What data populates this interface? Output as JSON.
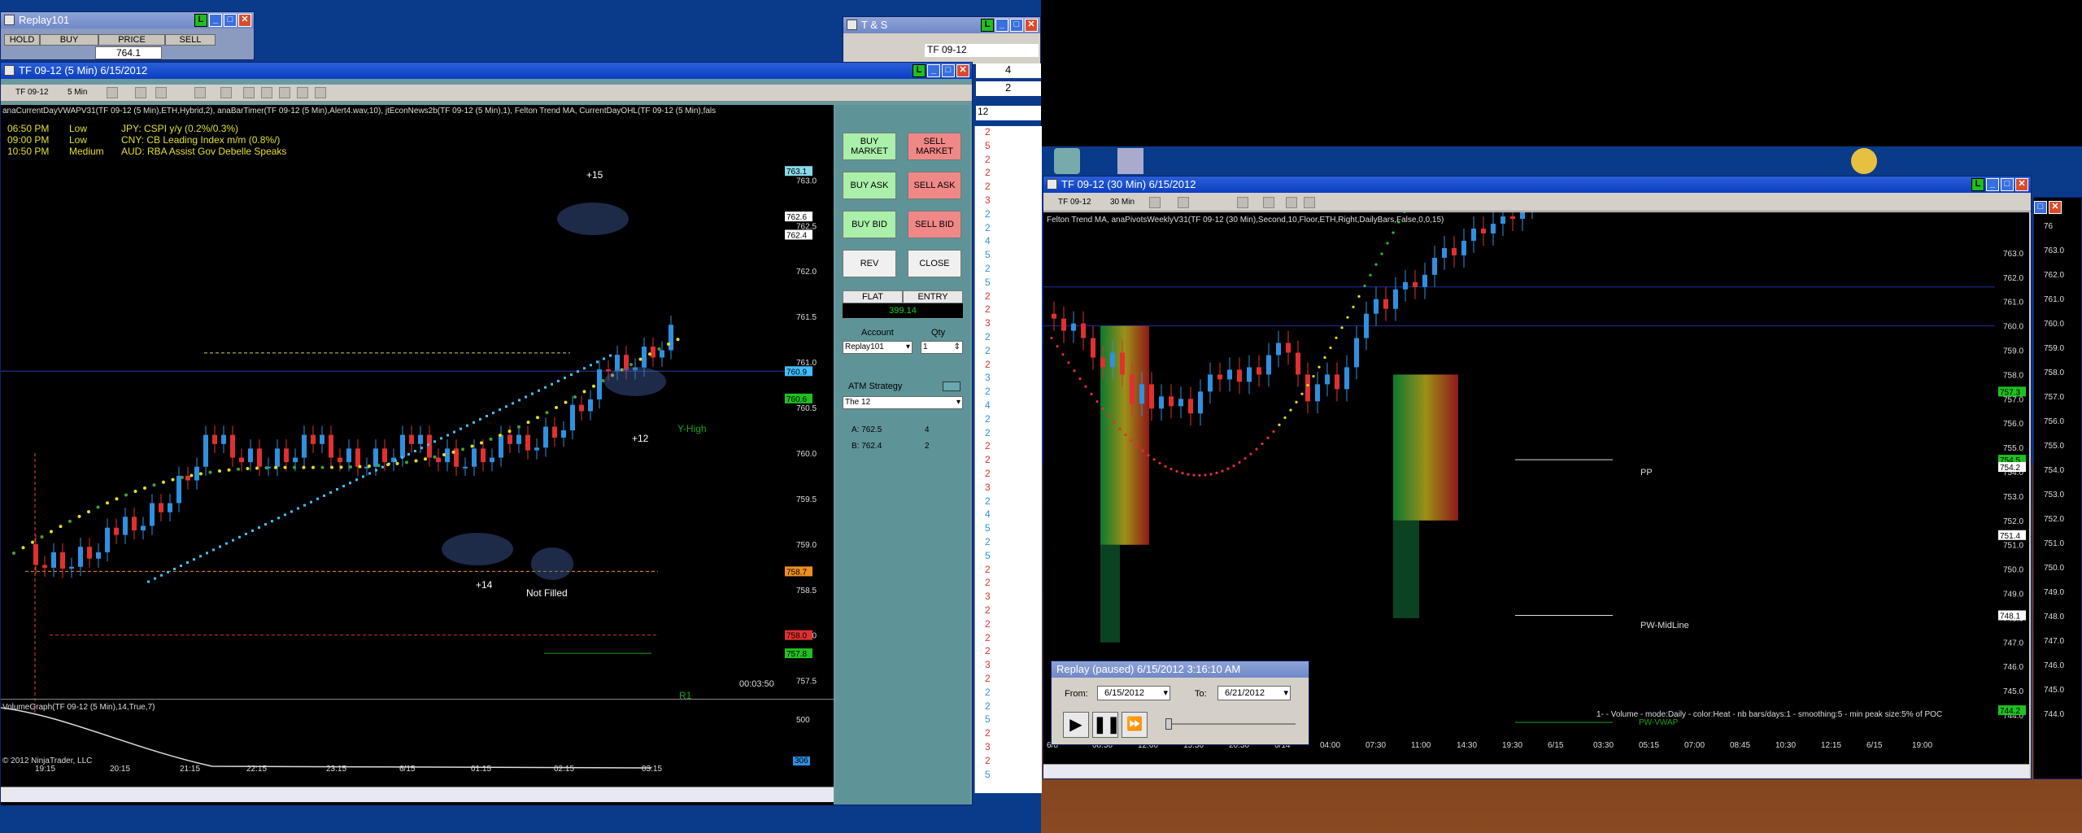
{
  "replay_win": {
    "title": "Replay101",
    "headers": [
      "HOLD",
      "BUY",
      "PRICE",
      "SELL"
    ],
    "price": "764.1"
  },
  "ts_win": {
    "title": "T & S",
    "instrument": "TF 09-12",
    "values": [
      "4",
      "2",
      "12"
    ]
  },
  "chart5": {
    "title": "TF 09-12 (5 Min)  6/15/2012",
    "toolbar": {
      "instrument": "TF 09-12",
      "interval": "5 Min"
    },
    "indicators": "anaCurrentDayVWAPV31(TF 09-12 (5 Min),ETH,Hybrid,2), anaBarTimer(TF 09-12 (5 Min),Alert4.wav,10), jtEconNews2b(TF 09-12 (5 Min),1), Felton Trend MA, CurrentDayOHL(TF 09-12 (5 Min),fals",
    "news": [
      {
        "time": "06:50 PM",
        "impact": "Low",
        "text": "JPY: CSPI y/y (0.2%/0.3%)",
        "color": "#e0e030"
      },
      {
        "time": "09:00 PM",
        "impact": "Low",
        "text": "CNY: CB Leading Index m/m (0.8%/)",
        "color": "#e0e030"
      },
      {
        "time": "10:50 PM",
        "impact": "Medium",
        "text": "AUD: RBA Assist Gov Debelle Speaks",
        "color": "#e0e030"
      }
    ],
    "y_labels": [
      "763.0",
      "762.5",
      "762.0",
      "761.5",
      "761.0",
      "760.5",
      "760.0",
      "759.5",
      "759.0",
      "758.5",
      "758.0",
      "757.5"
    ],
    "price_tags": [
      {
        "v": "763.1",
        "c": "#88d8e8"
      },
      {
        "v": "762.6",
        "c": "#ffffff"
      },
      {
        "v": "762.4",
        "c": "#ffffff"
      },
      {
        "v": "760.9",
        "c": "#40c0ff"
      },
      {
        "v": "760.6",
        "c": "#20c020"
      },
      {
        "v": "758.7",
        "c": "#f09020"
      },
      {
        "v": "758.0",
        "c": "#e03030"
      },
      {
        "v": "757.8",
        "c": "#20c020"
      }
    ],
    "annotations": [
      "+15",
      "+12",
      "+14",
      "Not Filled",
      "Y-High",
      "R1"
    ],
    "timer": "00:03:50",
    "x_labels": [
      "19:15",
      "20:15",
      "21:15",
      "22:15",
      "23:15",
      "6/15",
      "01:15",
      "02:15",
      "03:15"
    ],
    "volume_label": "VolumeGraph(TF 09-12 (5 Min),14,True,7)",
    "volume_y": "500",
    "volume_tag": "306",
    "copyright": "© 2012 NinjaTrader, LLC"
  },
  "chartTrader": {
    "buttons": {
      "buy_market": "BUY MARKET",
      "sell_market": "SELL MARKET",
      "buy_ask": "BUY ASK",
      "sell_ask": "SELL ASK",
      "buy_bid": "BUY BID",
      "sell_bid": "SELL BID",
      "rev": "REV",
      "close": "CLOSE"
    },
    "flat": "FLAT",
    "entry": "ENTRY",
    "pnl": "399.14",
    "account_label": "Account",
    "qty_label": "Qty",
    "account": "Replay101",
    "qty": "1",
    "atm_label": "ATM Strategy",
    "atm": "The 12",
    "a_label": "A: 762.5",
    "a_qty": "4",
    "b_label": "B: 762.4",
    "b_qty": "2"
  },
  "ts_list": [
    {
      "v": "2",
      "c": "#e03030"
    },
    {
      "v": "5",
      "c": "#e03030"
    },
    {
      "v": "2",
      "c": "#e03030"
    },
    {
      "v": "2",
      "c": "#e03030"
    },
    {
      "v": "2",
      "c": "#e03030"
    },
    {
      "v": "3",
      "c": "#e03030"
    },
    {
      "v": "2",
      "c": "#3090e0"
    },
    {
      "v": "2",
      "c": "#3090e0"
    },
    {
      "v": "4",
      "c": "#3090e0"
    },
    {
      "v": "5",
      "c": "#3090e0"
    },
    {
      "v": "2",
      "c": "#3090e0"
    },
    {
      "v": "5",
      "c": "#3090e0"
    },
    {
      "v": "2",
      "c": "#e03030"
    },
    {
      "v": "2",
      "c": "#e03030"
    },
    {
      "v": "3",
      "c": "#e03030"
    },
    {
      "v": "2",
      "c": "#3090e0"
    },
    {
      "v": "2",
      "c": "#3090e0"
    },
    {
      "v": "2",
      "c": "#e03030"
    },
    {
      "v": "3",
      "c": "#3090e0"
    },
    {
      "v": "2",
      "c": "#3090e0"
    },
    {
      "v": "4",
      "c": "#3090e0"
    },
    {
      "v": "2",
      "c": "#3090e0"
    },
    {
      "v": "2",
      "c": "#3090e0"
    },
    {
      "v": "2",
      "c": "#e03030"
    },
    {
      "v": "2",
      "c": "#e03030"
    },
    {
      "v": "2",
      "c": "#e03030"
    },
    {
      "v": "3",
      "c": "#e03030"
    },
    {
      "v": "2",
      "c": "#3090e0"
    },
    {
      "v": "4",
      "c": "#3090e0"
    },
    {
      "v": "5",
      "c": "#3090e0"
    },
    {
      "v": "2",
      "c": "#3090e0"
    },
    {
      "v": "5",
      "c": "#3090e0"
    },
    {
      "v": "2",
      "c": "#e03030"
    },
    {
      "v": "2",
      "c": "#e03030"
    },
    {
      "v": "3",
      "c": "#e03030"
    },
    {
      "v": "2",
      "c": "#e03030"
    },
    {
      "v": "2",
      "c": "#e03030"
    },
    {
      "v": "2",
      "c": "#e03030"
    },
    {
      "v": "2",
      "c": "#e03030"
    },
    {
      "v": "3",
      "c": "#e03030"
    },
    {
      "v": "2",
      "c": "#e03030"
    },
    {
      "v": "2",
      "c": "#3090e0"
    },
    {
      "v": "2",
      "c": "#3090e0"
    },
    {
      "v": "5",
      "c": "#3090e0"
    },
    {
      "v": "2",
      "c": "#e03030"
    },
    {
      "v": "3",
      "c": "#e03030"
    },
    {
      "v": "2",
      "c": "#e03030"
    },
    {
      "v": "5",
      "c": "#3090e0"
    }
  ],
  "chart30": {
    "title": "TF 09-12 (30 Min)  6/15/2012",
    "toolbar": {
      "instrument": "TF 09-12",
      "interval": "30 Min"
    },
    "indicators": "Felton Trend MA, anaPivotsWeeklyV31(TF 09-12 (30 Min),Second,10,Floor,ETH,Right,DailyBars,False,0,0,15)",
    "y_labels": [
      "763.0",
      "762.0",
      "761.0",
      "760.0",
      "759.0",
      "758.0",
      "757.0",
      "756.0",
      "755.0",
      "754.0",
      "753.0",
      "752.0",
      "751.0",
      "750.0",
      "749.0",
      "748.0",
      "747.0",
      "746.0",
      "745.0",
      "744.0"
    ],
    "price_tags": [
      {
        "v": "757.3",
        "c": "#20c020"
      },
      {
        "v": "754.5",
        "c": "#20c020"
      },
      {
        "v": "754.2",
        "c": "#ffffff"
      },
      {
        "v": "751.4",
        "c": "#ffffff"
      },
      {
        "v": "748.1",
        "c": "#ffffff"
      },
      {
        "v": "744.2",
        "c": "#20c020"
      }
    ],
    "levels": [
      "PP",
      "PW-MidLine"
    ],
    "vol_note": "1-  - Volume - mode:Daily - color:Heat - nb bars/days:1 - smoothing:5 - min peak size:5% of POC",
    "pw_vwap": "PW-VWAP",
    "x_labels": [
      "6/8",
      "08:30",
      "12:00",
      "15:30",
      "20:30",
      "6/14",
      "04:00",
      "07:30",
      "11:00",
      "14:30",
      "19:30",
      "6/15",
      "03:30",
      "05:15",
      "07:00",
      "08:45",
      "10:30",
      "12:15",
      "6/15",
      "19:00"
    ]
  },
  "right_partial": {
    "y_labels": [
      "76",
      "763.0",
      "762.0",
      "761.0",
      "760.0",
      "759.0",
      "758.0",
      "757.0",
      "756.0",
      "755.0",
      "754.0",
      "753.0",
      "752.0",
      "751.0",
      "750.0",
      "749.0",
      "748.0",
      "747.0",
      "746.0",
      "745.0",
      "744.0"
    ]
  },
  "replay_bar": {
    "title": "Replay (paused) 6/15/2012 3:16:10 AM",
    "from_label": "From:",
    "from": "6/15/2012",
    "to_label": "To:",
    "to": "6/21/2012"
  },
  "colors": {
    "desktop": "#0a3a8a",
    "up": "#3090e0",
    "down": "#e03030",
    "accent": "#2a5fd8"
  }
}
